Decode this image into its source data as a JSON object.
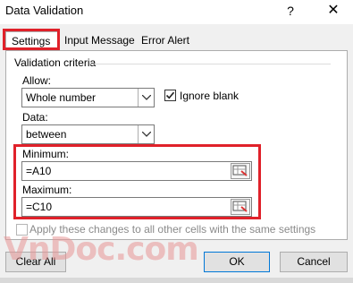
{
  "window": {
    "title": "Data Validation",
    "help_label": "?",
    "close_label": "✕"
  },
  "tabs": [
    {
      "label": "Settings",
      "selected": true
    },
    {
      "label": "Input Message",
      "selected": false
    },
    {
      "label": "Error Alert",
      "selected": false
    }
  ],
  "settings": {
    "group_title": "Validation criteria",
    "allow_label": "Allow:",
    "allow_value": "Whole number",
    "ignore_blank_label": "Ignore blank",
    "ignore_blank_checked": true,
    "data_label": "Data:",
    "data_value": "between",
    "minimum_label": "Minimum:",
    "minimum_value": "=A10",
    "maximum_label": "Maximum:",
    "maximum_value": "=C10",
    "apply_all_label": "Apply these changes to all other cells with the same settings",
    "apply_all_checked": false
  },
  "buttons": {
    "clear_all": "Clear All",
    "ok": "OK",
    "cancel": "Cancel"
  },
  "watermark": "VnDoc.com",
  "colors": {
    "highlight": "#e0212a",
    "dialog_bg": "#f0f0f0",
    "accent": "#0078d7"
  }
}
